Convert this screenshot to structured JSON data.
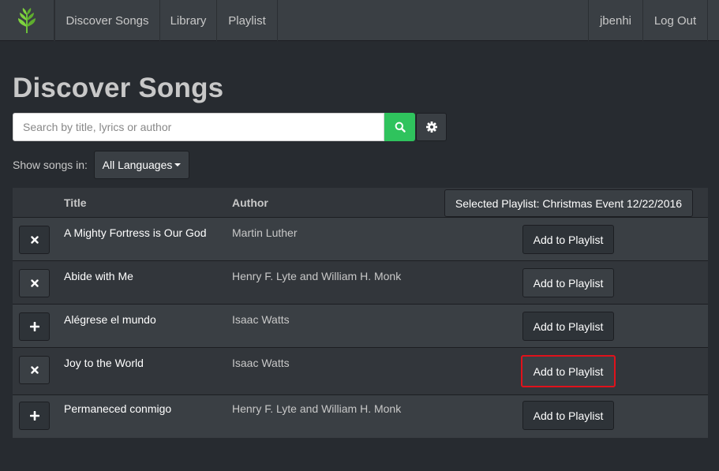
{
  "nav": {
    "brand_icon": "leaf-icon",
    "items": [
      {
        "label": "Discover Songs"
      },
      {
        "label": "Library"
      },
      {
        "label": "Playlist"
      }
    ],
    "user": "jbenhi",
    "logout": "Log Out"
  },
  "page": {
    "title": "Discover Songs"
  },
  "search": {
    "placeholder": "Search by title, lyrics or author",
    "value": "",
    "search_icon": "search-icon",
    "settings_icon": "gear-icon"
  },
  "filter": {
    "label": "Show songs in:",
    "language": "All Languages"
  },
  "table": {
    "headers": {
      "title": "Title",
      "author": "Author"
    },
    "selected_playlist": "Selected Playlist: Christmas Event 12/22/2016",
    "rows": [
      {
        "title": "A Mighty Fortress is Our God",
        "author": "Martin Luther",
        "toggle": "remove",
        "action": "Add to Playlist"
      },
      {
        "title": "Abide with Me",
        "author": "Henry F. Lyte and William H. Monk",
        "toggle": "remove",
        "action": "Add to Playlist"
      },
      {
        "title": "Alégrese el mundo",
        "author": "Isaac Watts",
        "toggle": "add",
        "action": "Add to Playlist"
      },
      {
        "title": "Joy to the World",
        "author": "Isaac Watts",
        "toggle": "remove",
        "action": "Add to Playlist"
      },
      {
        "title": "Permaneced conmigo",
        "author": "Henry F. Lyte and William H. Monk",
        "toggle": "add",
        "action": "Add to Playlist"
      }
    ]
  },
  "colors": {
    "background": "#272b30",
    "navbar": "#3a3f44",
    "search_button": "#2fc35d",
    "highlight": "#e0121b",
    "brand": "#5cb85c"
  }
}
